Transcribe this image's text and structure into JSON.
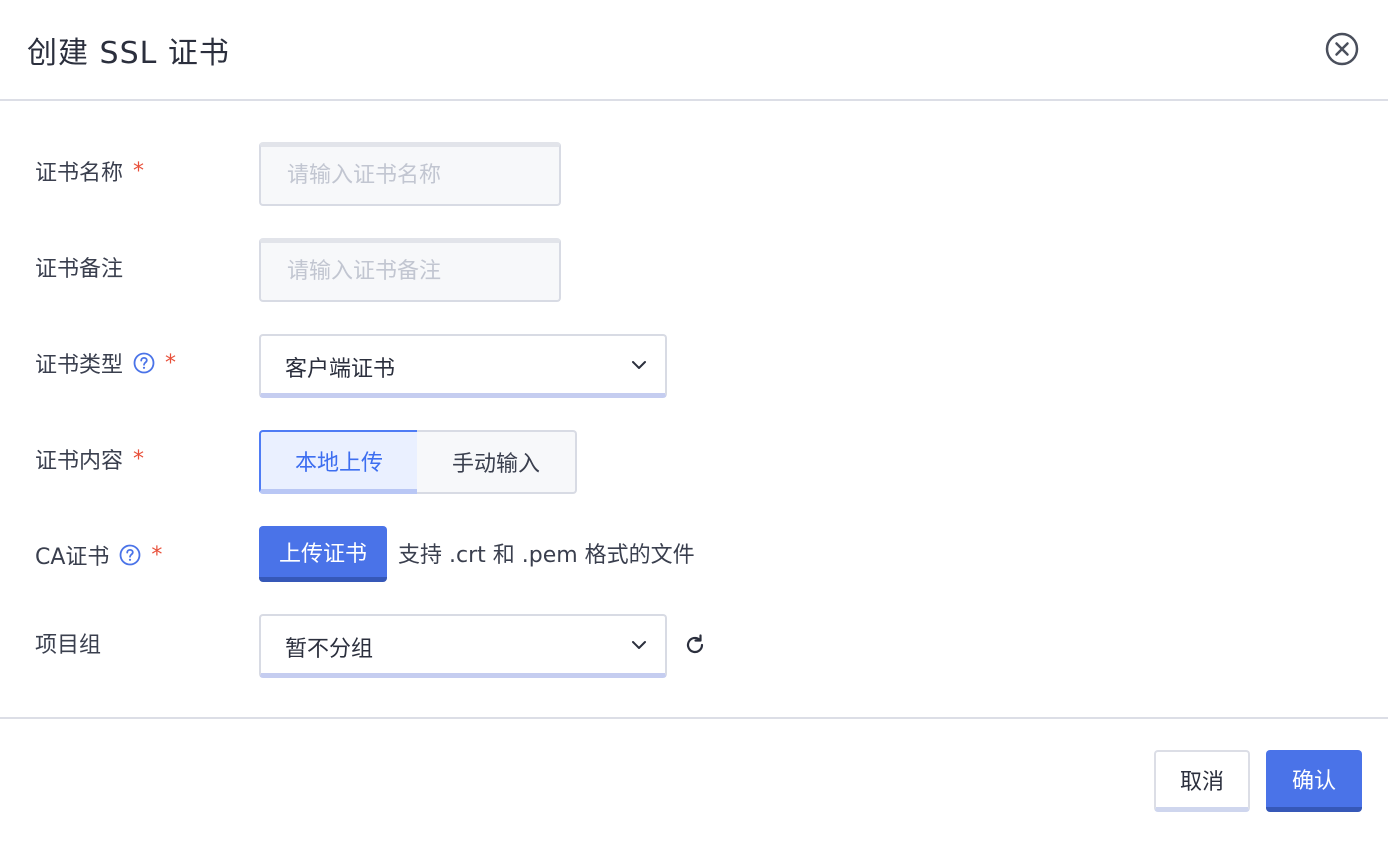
{
  "dialog": {
    "title": "创建 SSL 证书"
  },
  "form": {
    "name": {
      "label": "证书名称",
      "required": "*",
      "placeholder": "请输入证书名称",
      "value": ""
    },
    "remark": {
      "label": "证书备注",
      "placeholder": "请输入证书备注",
      "value": ""
    },
    "type": {
      "label": "证书类型",
      "required": "*",
      "value": "客户端证书"
    },
    "content": {
      "label": "证书内容",
      "required": "*",
      "options": [
        "本地上传",
        "手动输入"
      ],
      "selected": "本地上传"
    },
    "ca": {
      "label": "CA证书",
      "required": "*",
      "upload_label": "上传证书",
      "hint": "支持 .crt 和 .pem 格式的文件"
    },
    "group": {
      "label": "项目组",
      "value": "暂不分组"
    }
  },
  "footer": {
    "cancel_label": "取消",
    "confirm_label": "确认"
  },
  "colors": {
    "primary": "#4a73e8",
    "required": "#e8503a",
    "text": "#2b2f3d",
    "border": "#dcdee6"
  },
  "icons": {
    "close": "close-circle-icon",
    "help": "question-circle-icon",
    "chevron": "chevron-down-icon",
    "refresh": "refresh-icon"
  }
}
